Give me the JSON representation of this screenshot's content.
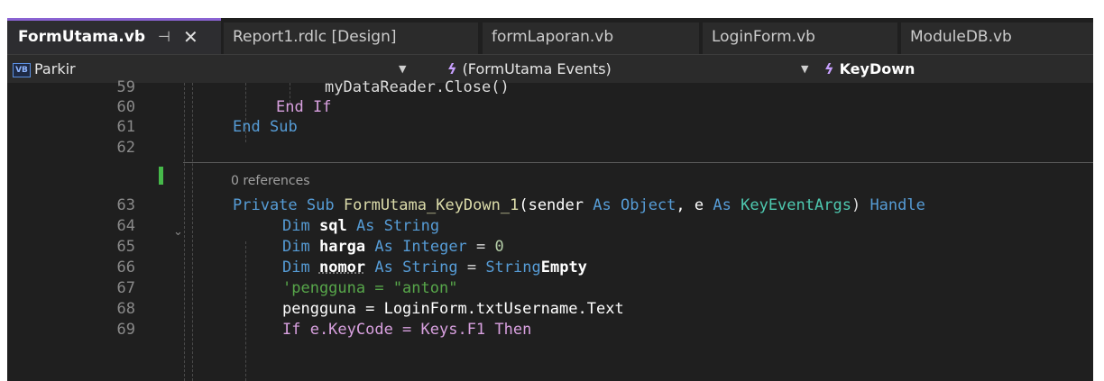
{
  "tabs": [
    {
      "label": "FormUtama.vb",
      "active": true
    },
    {
      "label": "Report1.rdlc [Design]"
    },
    {
      "label": "formLaporan.vb"
    },
    {
      "label": "LoginForm.vb"
    },
    {
      "label": "ModuleDB.vb"
    }
  ],
  "navbar": {
    "project_badge": "VB",
    "project": "Parkir",
    "events": "(FormUtama Events)",
    "member": "KeyDown"
  },
  "code": {
    "codelens": "0 references",
    "line_numbers": [
      "59",
      "60",
      "61",
      "62",
      "63",
      "64",
      "65",
      "66",
      "67",
      "68",
      "69"
    ],
    "lines": [
      {
        "t": "myDataReader.Close()"
      },
      {
        "a": "End",
        "b": "If"
      },
      {
        "a": "End",
        "b": "Sub"
      },
      {},
      {
        "a": "Private",
        "b": "Sub",
        "c": "FormUtama_KeyDown_1",
        "d": "(sender",
        "e": "As",
        "f": "Object",
        "g": ", e",
        "h": "As",
        "i": "KeyEventArgs",
        "j": ")",
        "k": "Handle"
      },
      {
        "a": "Dim",
        "b": "sql",
        "c": "As",
        "d": "String"
      },
      {
        "a": "Dim",
        "b": "harga",
        "c": "As",
        "d": "Integer",
        "e": "=",
        "f": "0"
      },
      {
        "a": "Dim",
        "b": "nomor",
        "c": "As",
        "d": "String",
        "e": "=",
        "f": "String",
        ".": ".",
        "g": "Empty"
      },
      {
        "t": "'pengguna = \"anton\""
      },
      {
        "t": "pengguna = LoginForm.txtUsername.Text"
      },
      {
        "t": "If e.KeyCode = Keys.F1 Then"
      }
    ]
  },
  "colors": {
    "accent": "#8a63d2",
    "editor_bg": "#1f1f1f",
    "change_bar": "#46b94a"
  }
}
